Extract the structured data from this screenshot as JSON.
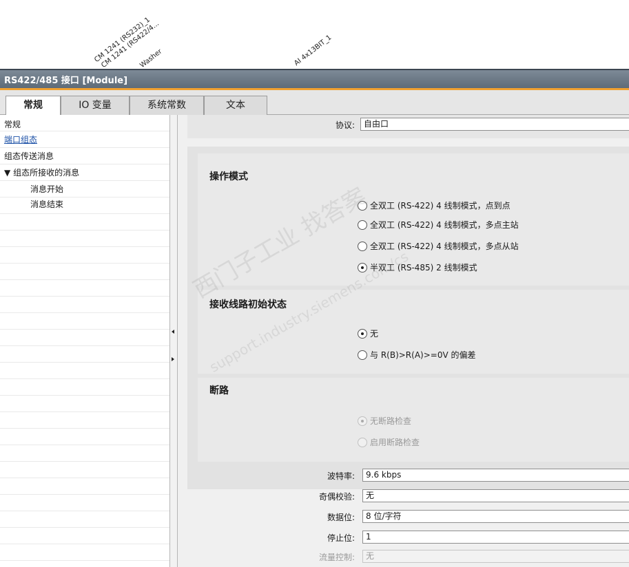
{
  "device_labels": [
    "CM 1241 (RS232)_1",
    "CM 1241 (RS422/4...",
    "Washer",
    "AI 4x13BIT_1"
  ],
  "window": {
    "title": "RS422/485 接口 [Module]"
  },
  "tabs": [
    {
      "label": "常规"
    },
    {
      "label": "IO 变量"
    },
    {
      "label": "系统常数"
    },
    {
      "label": "文本"
    }
  ],
  "nav": {
    "items": [
      {
        "label": "常规"
      },
      {
        "label": "端口组态"
      },
      {
        "label": "组态传送消息"
      },
      {
        "label": "组态所接收的消息",
        "expander": "▼"
      },
      {
        "label": "消息开始"
      },
      {
        "label": "消息结束"
      }
    ]
  },
  "protocol": {
    "label": "协议:",
    "value": "自由口"
  },
  "operating_mode": {
    "title": "操作模式",
    "options": [
      "全双工 (RS-422) 4 线制模式，点到点",
      "全双工 (RS-422) 4 线制模式，多点主站",
      "全双工 (RS-422) 4 线制模式，多点从站",
      "半双工 (RS-485) 2 线制模式"
    ],
    "selected_index": 3
  },
  "receive_line": {
    "title": "接收线路初始状态",
    "options": [
      "无",
      "与 R(B)>R(A)>=0V 的偏差"
    ],
    "selected_index": 0
  },
  "break_detect": {
    "title": "断路",
    "options": [
      "无断路检查",
      "启用断路检查"
    ],
    "selected_index": 0
  },
  "settings": {
    "baud": {
      "label": "波特率:",
      "value": "9.6 kbps"
    },
    "parity": {
      "label": "奇偶校验:",
      "value": "无"
    },
    "data_bits": {
      "label": "数据位:",
      "value": "8 位/字符"
    },
    "stop_bits": {
      "label": "停止位:",
      "value": "1"
    },
    "flow_control": {
      "label": "流量控制:",
      "value": "无"
    }
  },
  "watermark": {
    "line1": "西门子工业 找答案",
    "line2": "support.industry.siemens.com/cs"
  }
}
